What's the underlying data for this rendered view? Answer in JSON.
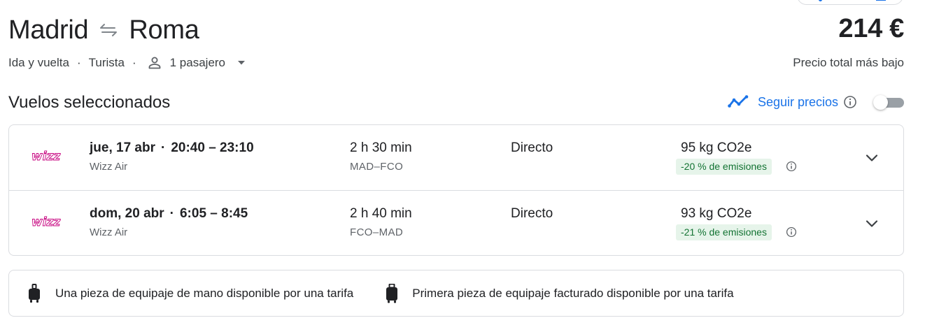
{
  "header": {
    "origin": "Madrid",
    "destination": "Roma",
    "swap_icon": "swap-arrows-icon",
    "price": "214 €",
    "price_label": "Precio total más bajo",
    "trip_type": "Ida y vuelta",
    "separator": "·",
    "cabin_class": "Turista",
    "passengers": "1 pasajero"
  },
  "section": {
    "title": "Vuelos seleccionados",
    "track_label": "Seguir precios",
    "track_enabled": false
  },
  "colors": {
    "accent": "#1a73e8",
    "emissions_bg": "#e6f4ea",
    "emissions_text": "#137333",
    "wizz_logo": "#c6007e"
  },
  "flights": [
    {
      "date": "jue, 17 abr",
      "times": "20:40 – 23:10",
      "airline": "Wizz Air",
      "logo_text": "wizz",
      "duration": "2 h 30 min",
      "route": "MAD–FCO",
      "stops": "Directo",
      "co2": "95 kg CO2e",
      "emissions": "-20 % de emisiones"
    },
    {
      "date": "dom, 20 abr",
      "times": "6:05 – 8:45",
      "airline": "Wizz Air",
      "logo_text": "wizz",
      "duration": "2 h 40 min",
      "route": "FCO–MAD",
      "stops": "Directo",
      "co2": "93 kg CO2e",
      "emissions": "-21 % de emisiones"
    }
  ],
  "baggage": {
    "carry_on": "Una pieza de equipaje de mano disponible por una tarifa",
    "checked": "Primera pieza de equipaje facturado disponible por una tarifa"
  }
}
